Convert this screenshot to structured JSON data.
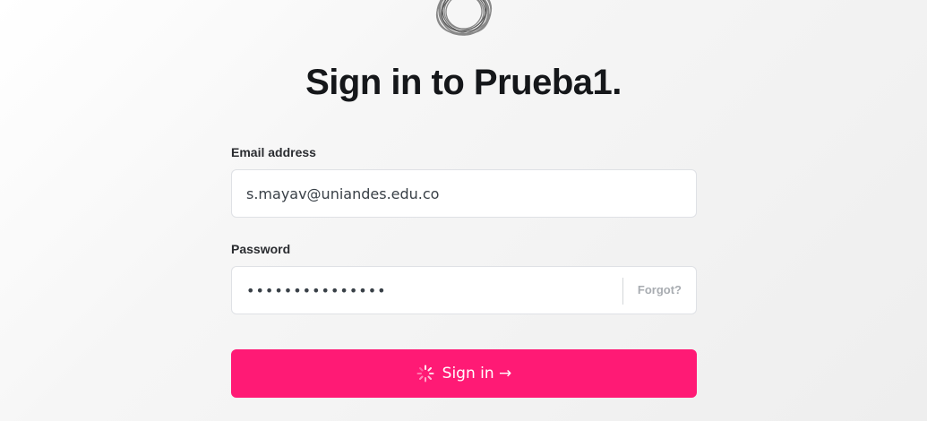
{
  "title": "Sign in to Prueba1.",
  "email": {
    "label": "Email address",
    "value": "s.mayav@uniandes.edu.co"
  },
  "password": {
    "label": "Password",
    "value": "•••••••••••••••",
    "forgot_label": "Forgot?"
  },
  "submit": {
    "label": "Sign in →",
    "loading": true
  },
  "colors": {
    "accent": "#ff1a75",
    "title": "#15171a",
    "muted": "#a8acb1",
    "input_border": "#dfe1e5"
  },
  "icons": {
    "logo": "site-logo-icon",
    "spinner": "loading-spinner-icon"
  }
}
